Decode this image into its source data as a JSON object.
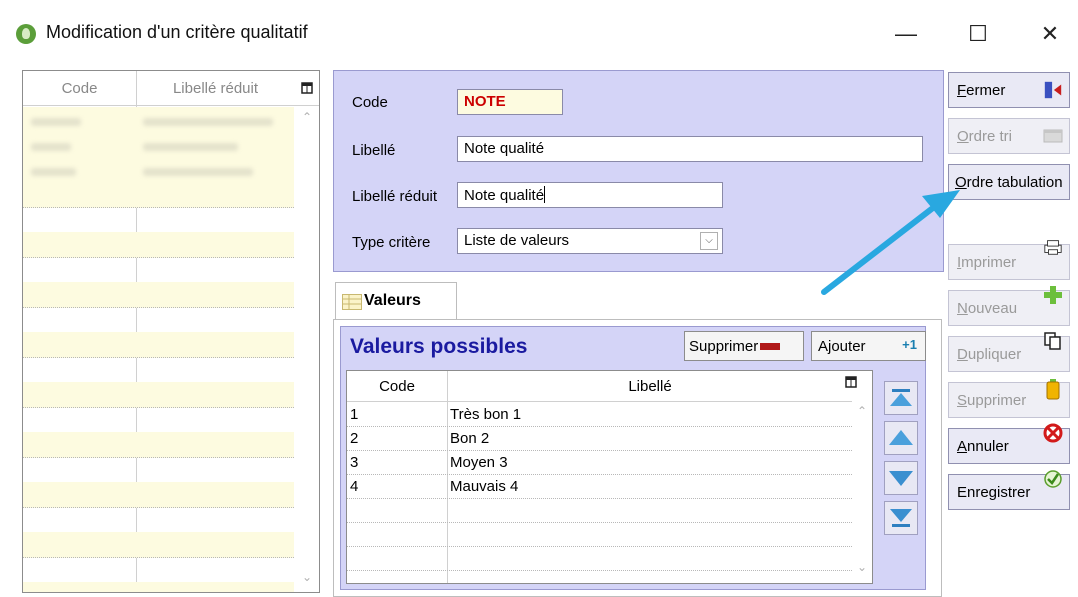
{
  "window": {
    "title": "Modification d'un critère qualitatif",
    "minimize": "—",
    "maximize": "☐",
    "close": "✕"
  },
  "left_grid": {
    "columns": [
      "Code",
      "Libellé réduit"
    ],
    "column_menu_icon": "table-columns-icon"
  },
  "form": {
    "code_label": "Code",
    "code_value": "NOTE",
    "libelle_label": "Libellé",
    "libelle_value": "Note qualité",
    "libelle_reduit_label": "Libellé réduit",
    "libelle_reduit_value": "Note qualité",
    "type_label": "Type critère",
    "type_value": "Liste de valeurs"
  },
  "tab": {
    "label": "Valeurs"
  },
  "valeurs": {
    "title": "Valeurs possibles",
    "delete_label": "Supprimer",
    "add_label": "Ajouter",
    "columns": [
      "Code",
      "Libellé"
    ],
    "rows": [
      {
        "code": "1",
        "libelle": "Très bon 1"
      },
      {
        "code": "2",
        "libelle": "Bon 2"
      },
      {
        "code": "3",
        "libelle": "Moyen 3"
      },
      {
        "code": "4",
        "libelle": "Mauvais 4"
      }
    ]
  },
  "actions": {
    "fermer": "Fermer",
    "ordre_tri": "Ordre tri",
    "ordre_tabulation": "Ordre tabulation",
    "imprimer": "Imprimer",
    "nouveau": "Nouveau",
    "dupliquer": "Dupliquer",
    "supprimer": "Supprimer",
    "annuler": "Annuler",
    "enregistrer": "Enregistrer"
  },
  "colors": {
    "panel": "#d4d4f7",
    "title_blue": "#1a1aa0",
    "code_red": "#cc0000",
    "annotation_arrow": "#29a8e0"
  }
}
